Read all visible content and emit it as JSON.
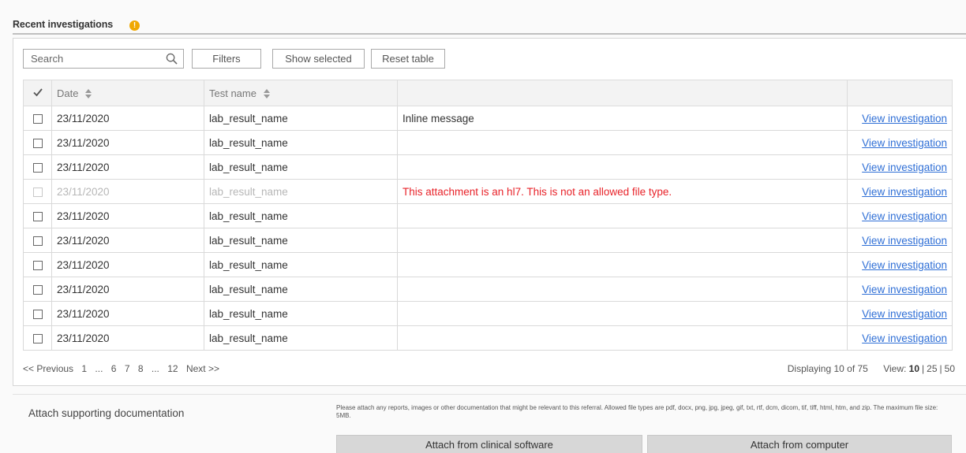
{
  "section": {
    "title": "Recent investigations",
    "info_icon": "!"
  },
  "toolbar": {
    "search_placeholder": "Search",
    "filters_label": "Filters",
    "show_selected_label": "Show selected",
    "reset_label": "Reset table"
  },
  "table": {
    "headers": {
      "date": "Date",
      "test_name": "Test name"
    },
    "rows": [
      {
        "date": "23/11/2020",
        "test": "lab_result_name",
        "message": "Inline message",
        "link": "View investigation",
        "disabled": false
      },
      {
        "date": "23/11/2020",
        "test": "lab_result_name",
        "message": "",
        "link": "View investigation",
        "disabled": false
      },
      {
        "date": "23/11/2020",
        "test": "lab_result_name",
        "message": "",
        "link": "View investigation",
        "disabled": false
      },
      {
        "date": "23/11/2020",
        "test": "lab_result_name",
        "message": "This attachment is an hl7. This is not an allowed file type.",
        "link": "View investigation",
        "disabled": true
      },
      {
        "date": "23/11/2020",
        "test": "lab_result_name",
        "message": "",
        "link": "View investigation",
        "disabled": false
      },
      {
        "date": "23/11/2020",
        "test": "lab_result_name",
        "message": "",
        "link": "View investigation",
        "disabled": false
      },
      {
        "date": "23/11/2020",
        "test": "lab_result_name",
        "message": "",
        "link": "View investigation",
        "disabled": false
      },
      {
        "date": "23/11/2020",
        "test": "lab_result_name",
        "message": "",
        "link": "View investigation",
        "disabled": false
      },
      {
        "date": "23/11/2020",
        "test": "lab_result_name",
        "message": "",
        "link": "View investigation",
        "disabled": false
      },
      {
        "date": "23/11/2020",
        "test": "lab_result_name",
        "message": "",
        "link": "View investigation",
        "disabled": false
      }
    ]
  },
  "pagination": {
    "previous": "<< Previous",
    "pages": [
      "1",
      "...",
      "6",
      "7",
      "8",
      "...",
      "12"
    ],
    "next": "Next >>",
    "displaying": "Displaying 10 of 75",
    "view_label": "View:",
    "view_options": [
      "10",
      "25",
      "50"
    ],
    "view_selected": "10"
  },
  "attach": {
    "label": "Attach supporting documentation",
    "note": "Please attach any reports, images or other documentation that might be relevant to this referral. Allowed file types are pdf, docx, png, jpg, jpeg, gif, txt, rtf, dcm, dicom, tif, tiff, html, htm, and zip. The maximum file size: 5MB.",
    "clinical_button": "Attach from clinical software",
    "computer_button": "Attach from computer"
  },
  "colors": {
    "accent_link": "#2f6fd6",
    "error": "#e8232a",
    "info": "#f0a800"
  }
}
